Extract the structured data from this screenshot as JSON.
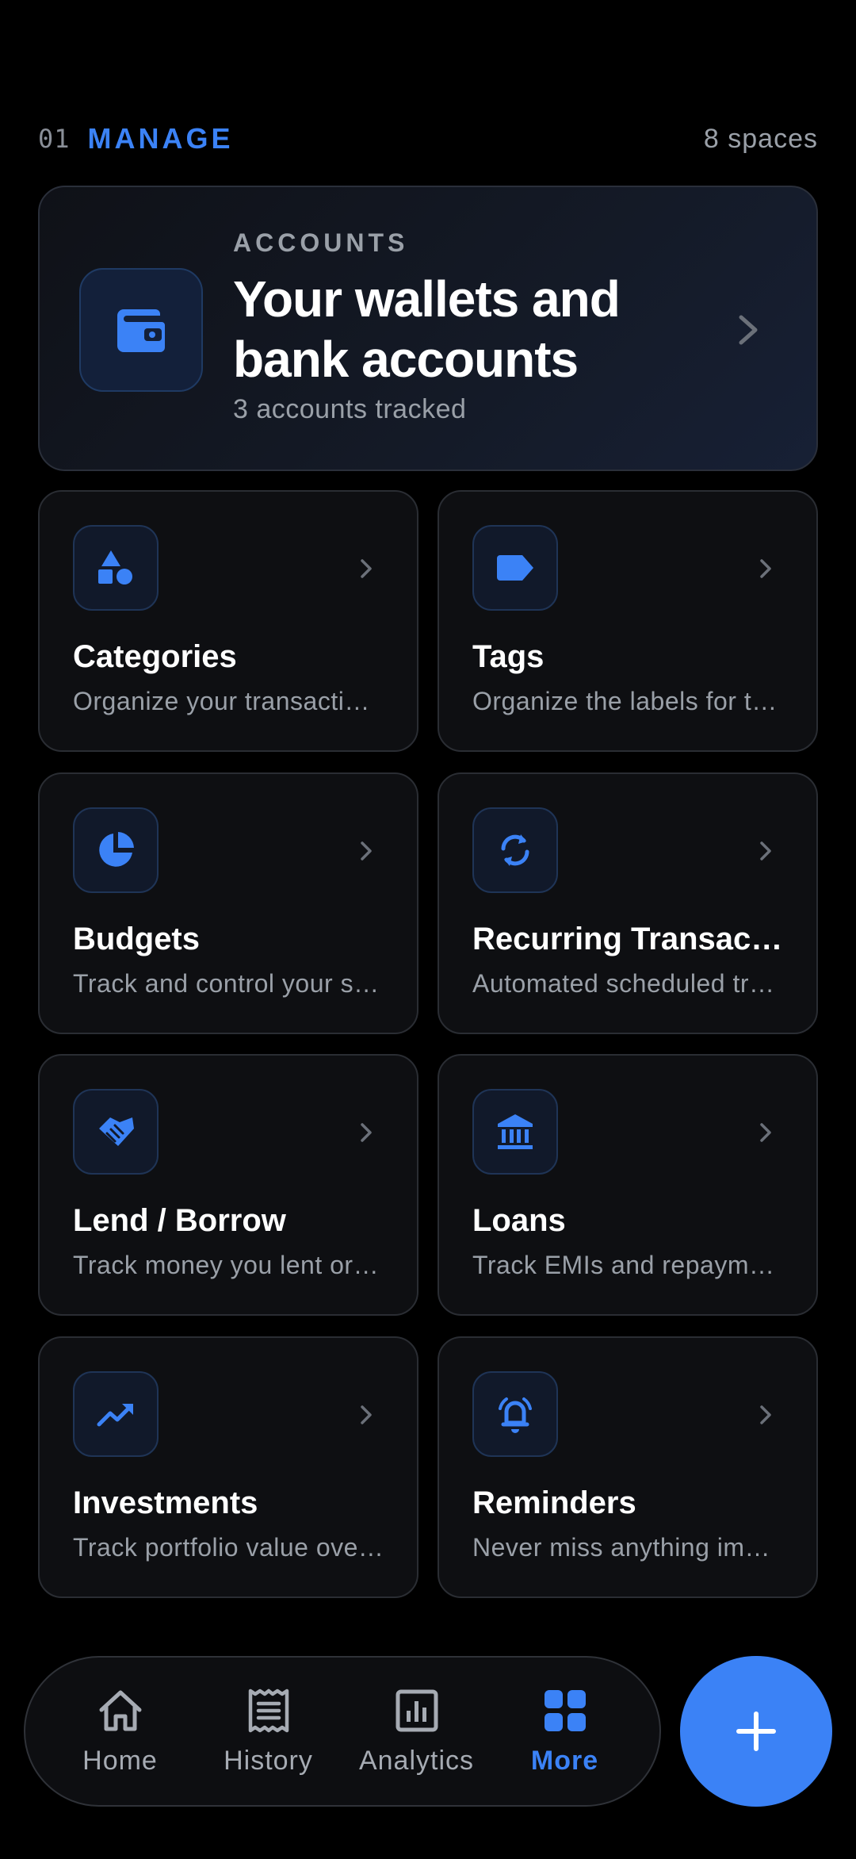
{
  "section": {
    "number": "01",
    "title": "MANAGE",
    "count": "8 spaces"
  },
  "hero": {
    "kicker": "ACCOUNTS",
    "title": "Your wallets and bank accounts",
    "subtitle": "3 accounts tracked",
    "icon": "wallet-icon"
  },
  "cards": [
    {
      "title": "Categories",
      "subtitle": "Organize your transactions",
      "icon": "shapes-icon"
    },
    {
      "title": "Tags",
      "subtitle": "Organize the labels for transactions",
      "icon": "tag-icon"
    },
    {
      "title": "Budgets",
      "subtitle": "Track and control your spending",
      "icon": "pie-chart-icon"
    },
    {
      "title": "Recurring Transactions",
      "subtitle": "Automated scheduled transactions",
      "icon": "refresh-icon"
    },
    {
      "title": "Lend / Borrow",
      "subtitle": "Track money you lent or borrowed",
      "icon": "handshake-icon"
    },
    {
      "title": "Loans",
      "subtitle": "Track EMIs and repayments",
      "icon": "bank-icon"
    },
    {
      "title": "Investments",
      "subtitle": "Track portfolio value over time",
      "icon": "trend-up-icon"
    },
    {
      "title": "Reminders",
      "subtitle": "Never miss anything important",
      "icon": "alarm-icon"
    }
  ],
  "nav": {
    "items": [
      {
        "label": "Home",
        "icon": "home-icon"
      },
      {
        "label": "History",
        "icon": "receipt-icon"
      },
      {
        "label": "Analytics",
        "icon": "bar-chart-icon"
      },
      {
        "label": "More",
        "icon": "grid-icon"
      }
    ],
    "active": "More"
  },
  "fab": {
    "icon": "plus-icon"
  },
  "colors": {
    "accent": "#3b82f6",
    "background": "#000000",
    "card": "#0e0f12",
    "muted_text": "#9aa0a8"
  }
}
